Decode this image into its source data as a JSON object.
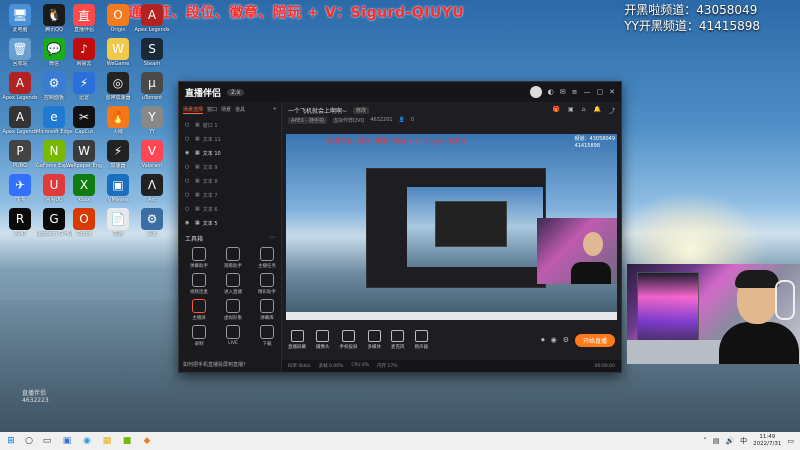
{
  "overlay": {
    "top_text": "接 通行证、段位、徽章、陪玩 + V：Sigurd-QIUYU",
    "channel_1": "开黑啦频道：43058049",
    "channel_2": "YY开黑频道：41415898"
  },
  "desktop_icons": [
    {
      "label": "此电脑",
      "color": "#4a90d9",
      "glyph": "🖥"
    },
    {
      "label": "腾讯QQ",
      "color": "#1a1a1a",
      "glyph": "🐧"
    },
    {
      "label": "直播伴侣",
      "color": "#ff4a4a",
      "glyph": "直"
    },
    {
      "label": "Origin",
      "color": "#f47a20",
      "glyph": "O"
    },
    {
      "label": "Apex Legends",
      "color": "#b22222",
      "glyph": "A"
    },
    {
      "label": "回收站",
      "color": "#6aa0d0",
      "glyph": "🗑"
    },
    {
      "label": "微信",
      "color": "#1aad19",
      "glyph": "💬"
    },
    {
      "label": "网易云",
      "color": "#c20c0c",
      "glyph": "♪"
    },
    {
      "label": "WeGame",
      "color": "#f2c84b",
      "glyph": "W"
    },
    {
      "label": "Steam",
      "color": "#1b2838",
      "glyph": "S"
    },
    {
      "label": "Apex Legends",
      "color": "#b22222",
      "glyph": "A"
    },
    {
      "label": "控制面板",
      "color": "#3a7bd5",
      "glyph": "⚙"
    },
    {
      "label": "迅雷",
      "color": "#2a6fdb",
      "glyph": "⚡"
    },
    {
      "label": "雷神加速器",
      "color": "#222",
      "glyph": "◎"
    },
    {
      "label": "uTorrent",
      "color": "#4a4a4a",
      "glyph": "µ"
    },
    {
      "label": "Apex Legends",
      "color": "#333",
      "glyph": "A"
    },
    {
      "label": "Microsoft Edge",
      "color": "#1f7ad4",
      "glyph": "e"
    },
    {
      "label": "CapCut",
      "color": "#111",
      "glyph": "✂"
    },
    {
      "label": "火绒",
      "color": "#f07a1a",
      "glyph": "🔥"
    },
    {
      "label": "YY",
      "color": "#888",
      "glyph": "Y"
    },
    {
      "label": "PUBG",
      "color": "#444",
      "glyph": "P"
    },
    {
      "label": "GeForce Experience",
      "color": "#76b900",
      "glyph": "N"
    },
    {
      "label": "Wallpaper Engine",
      "color": "#3a3a3a",
      "glyph": "W"
    },
    {
      "label": "加速器",
      "color": "#222",
      "glyph": "⚡"
    },
    {
      "label": "Valorant",
      "color": "#ff4655",
      "glyph": "V"
    },
    {
      "label": "飞书",
      "color": "#3370ff",
      "glyph": "✈"
    },
    {
      "label": "网易UU",
      "color": "#e03a3a",
      "glyph": "U"
    },
    {
      "label": "Xbox",
      "color": "#107c10",
      "glyph": "X"
    },
    {
      "label": "VMware",
      "color": "#1a6fbf",
      "glyph": "▣"
    },
    {
      "label": "Arc",
      "color": "#222",
      "glyph": "Λ"
    },
    {
      "label": "AMD",
      "color": "#0a0a0a",
      "glyph": "R"
    },
    {
      "label": "Logitech G HUB",
      "color": "#0a0a0a",
      "glyph": "G"
    },
    {
      "label": "Office",
      "color": "#d83b01",
      "glyph": "O"
    },
    {
      "label": "文档",
      "color": "#e8e8e8",
      "glyph": "📄"
    },
    {
      "label": "设置",
      "color": "#3a6ea5",
      "glyph": "⚙"
    }
  ],
  "window": {
    "app_name": "直播伴侣",
    "version": "2.x",
    "tabs": [
      "场景选择",
      "窗口",
      "场景",
      "道具"
    ],
    "scenes": [
      {
        "label": "窗口 1",
        "on": false
      },
      {
        "label": "文本 11",
        "on": false
      },
      {
        "label": "文本 10",
        "on": true
      },
      {
        "label": "文本 9",
        "on": false
      },
      {
        "label": "文本 8",
        "on": false
      },
      {
        "label": "文本 7",
        "on": false
      },
      {
        "label": "文本 6",
        "on": false
      },
      {
        "label": "文本 5",
        "on": true
      }
    ],
    "tools_title": "工具箱",
    "tools": [
      {
        "label": "弹幕助手",
        "hot": false
      },
      {
        "label": "观看助手",
        "hot": false
      },
      {
        "label": "主播任务",
        "hot": false
      },
      {
        "label": "视频连麦",
        "hot": false
      },
      {
        "label": "进入直播",
        "hot": false
      },
      {
        "label": "精彩助手",
        "hot": false
      },
      {
        "label": "主播屏",
        "hot": true
      },
      {
        "label": "虚拟形象",
        "hot": false
      },
      {
        "label": "弹幕库",
        "hot": false
      },
      {
        "label": "录制",
        "hot": false
      },
      {
        "label": "LIVE",
        "hot": false
      },
      {
        "label": "下载",
        "hot": false
      }
    ],
    "tip": "如何把手机直播投屏到直播？",
    "room_title": "一个飞机就会上啊啊~",
    "room_edit": "修改",
    "category": "APEX - 随手拍",
    "room_tag": "虚拟作弊QVQ",
    "room_id": "4632201",
    "viewers": "0",
    "preview_overlay": "接 通行证、段位、徽章、陪玩 + V：Sigurd-QIUYU",
    "preview_right_1": "频道：43058049",
    "preview_right_2": "41415898",
    "controls": [
      "直播屏幕",
      "摄像头",
      "手机投屏",
      "多媒体",
      "麦克风",
      "扬声器"
    ],
    "go_live": "开始直播",
    "status": [
      "码率 0kb/s",
      "丢帧 0.00%",
      "CPU 8%",
      "内存 17%"
    ],
    "status_time": "00:00:00"
  },
  "watermark": {
    "number": "4632223",
    "logo": "直播伴侣"
  },
  "taskbar": {
    "time": "11:49",
    "date": "2022/7/31",
    "lang": "中",
    "apps": [
      {
        "label": "start",
        "glyph": "⊞",
        "color": "#0078d4"
      },
      {
        "label": "search",
        "glyph": "○",
        "color": "#333"
      },
      {
        "label": "taskview",
        "glyph": "▭",
        "color": "#333"
      },
      {
        "label": "app1",
        "glyph": "▣",
        "color": "#3a6fd0"
      },
      {
        "label": "app2",
        "glyph": "◉",
        "color": "#2aa0d8"
      },
      {
        "label": "app3",
        "glyph": "▦",
        "color": "#e8b020"
      },
      {
        "label": "app4",
        "glyph": "■",
        "color": "#76b900"
      },
      {
        "label": "app5",
        "glyph": "◆",
        "color": "#f07a1a"
      }
    ]
  }
}
